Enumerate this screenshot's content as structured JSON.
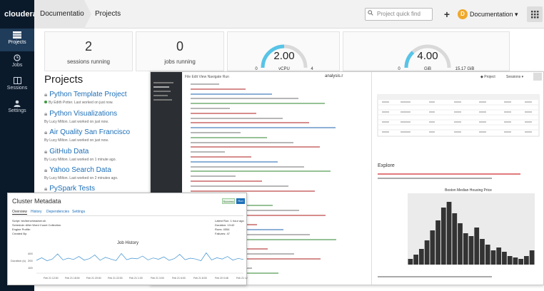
{
  "brand": {
    "logo": "cloudera"
  },
  "breadcrumb": {
    "first": "Documentation",
    "second": "Projects"
  },
  "search": {
    "placeholder": "Project quick find"
  },
  "user": {
    "initial": "D",
    "name": "Documentation ▾"
  },
  "sidebar": {
    "items": [
      {
        "label": "Projects",
        "icon": "projects-icon"
      },
      {
        "label": "Jobs",
        "icon": "clock-icon"
      },
      {
        "label": "Sessions",
        "icon": "sessions-icon"
      },
      {
        "label": "Settings",
        "icon": "user-icon"
      }
    ]
  },
  "stats": {
    "sessions": {
      "value": "2",
      "label": "sessions running"
    },
    "jobs": {
      "value": "0",
      "label": "jobs running"
    },
    "vcpu": {
      "value": "2.00",
      "min": "0",
      "max": "4",
      "unit": "vCPU",
      "fill": 0.5
    },
    "memory": {
      "value": "4.00",
      "min": "0",
      "max": "15.17 GiB",
      "unit": "GiB",
      "fill": 0.26
    }
  },
  "projects": {
    "title": "Projects",
    "items": [
      {
        "name": "Python Template Project",
        "meta": "By Edith Potter. Last worked on just now."
      },
      {
        "name": "Python Visualizations",
        "meta": "By Lucy Milton. Last worked on just now."
      },
      {
        "name": "Air Quality San Francisco",
        "meta": "By Lucy Milton. Last worked on just now."
      },
      {
        "name": "GitHub Data",
        "meta": "By Lucy Milton. Last worked on 1 minute ago."
      },
      {
        "name": "Yahoo Search Data",
        "meta": "By Lucy Milton. Last worked on 2 minutes ago."
      },
      {
        "name": "PySpark Tests",
        "meta": ""
      }
    ]
  },
  "editor": {
    "menu": "File   Edit   View   Navigate   Run",
    "filename": "analysis.r",
    "project_btn": "◆ Project",
    "sessions_btn": "Sessions ▾",
    "explore_heading": "Explore",
    "plot_title": "Boston Median Housing Price"
  },
  "metadata": {
    "title": "Cluster Metadata",
    "tabs": [
      "Overview",
      "History",
      "Dependencies",
      "Settings"
    ],
    "chart_title": "Job History",
    "badge_success": "Success",
    "badge_run": "Run",
    "fields_left": [
      "Script: bin/benchmarker.sh",
      "Schedule: After Word Count Collection",
      "Engine Profile:",
      "Created By:"
    ],
    "fields_right": [
      "Latest Run: 1 hour ago",
      "Duration: 13:42",
      "Runs: 4054",
      "Failures: 47"
    ],
    "y_label": "Duration (s)",
    "y_ticks": [
      "400",
      "200",
      "100"
    ],
    "x_ticks": [
      "Feb 21 12:00",
      "Feb 21 18:00",
      "Feb 21 20:00",
      "Feb 21 22:00",
      "Feb 21 1:00",
      "Feb 21 3:00",
      "Feb 21 6:00",
      "Feb 21 8:00",
      "Feb 20 0:48",
      "Feb 21 12:00"
    ]
  },
  "chart_data": {
    "type": "line",
    "title": "Job History",
    "ylabel": "Duration (s)",
    "values": [
      60,
      72,
      58,
      66,
      90,
      62,
      70,
      64,
      78,
      61,
      68,
      85,
      60,
      74,
      66,
      59,
      92,
      63,
      70,
      67,
      80,
      62,
      71,
      65,
      76,
      60,
      68,
      88,
      63,
      70,
      66,
      58,
      95,
      62,
      72,
      66,
      78,
      61,
      69,
      64
    ]
  },
  "colors": {
    "accent": "#1d6fb8",
    "sidebar": "#0b1a2b",
    "gauge": "#57c4e8",
    "gauge_bg": "#d9d9d9"
  }
}
